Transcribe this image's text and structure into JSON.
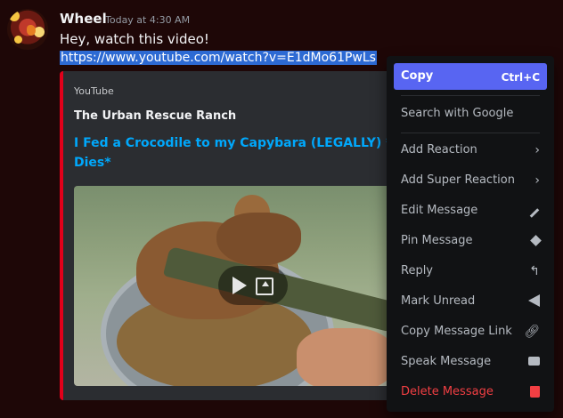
{
  "message": {
    "username": "Wheel",
    "timestamp": "Today at 4:30 AM",
    "text": "Hey, watch this video!",
    "link": "https://www.youtube.com/watch?v=E1dMo61PwLs"
  },
  "embed": {
    "provider": "YouTube",
    "author": "The Urban Rescue Ranch",
    "title": "I Fed a Crocodile to my Capybara (LEGALLY) *Big C Dies*",
    "accent_color": "#e1001a"
  },
  "context_menu": {
    "items": [
      {
        "label": "Copy",
        "shortcut": "Ctrl+C"
      },
      {
        "label": "Search with Google"
      },
      {
        "label": "Add Reaction",
        "icon": "chevron-right-icon"
      },
      {
        "label": "Add Super Reaction",
        "icon": "chevron-right-icon"
      },
      {
        "label": "Edit Message",
        "icon": "pencil-icon"
      },
      {
        "label": "Pin Message",
        "icon": "pin-icon"
      },
      {
        "label": "Reply",
        "icon": "reply-arrow-icon"
      },
      {
        "label": "Mark Unread",
        "icon": "mark-unread-icon"
      },
      {
        "label": "Copy Message Link",
        "icon": "link-icon"
      },
      {
        "label": "Speak Message",
        "icon": "speak-message-icon"
      },
      {
        "label": "Delete Message",
        "icon": "trash-icon"
      }
    ],
    "highlight_color": "#5865f2",
    "danger_color": "#f23f43"
  }
}
